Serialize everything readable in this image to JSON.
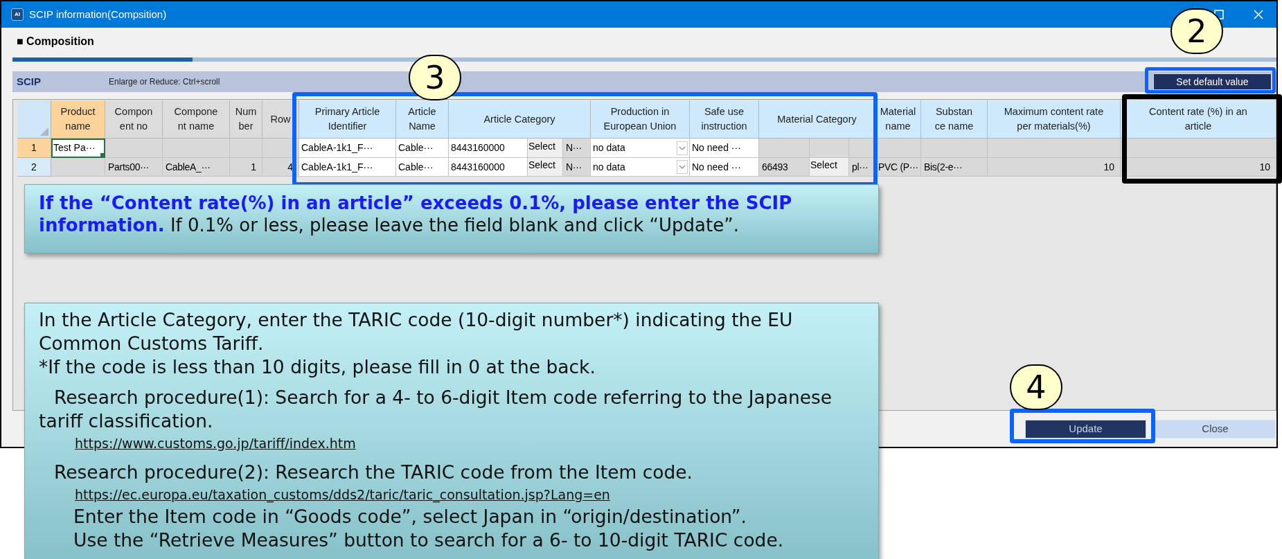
{
  "window": {
    "icon_label": "AI",
    "title": "SCIP information(Compsition)",
    "controls": [
      {
        "kind": "maximize"
      },
      {
        "kind": "close"
      }
    ]
  },
  "section": {
    "title": "■ Composition"
  },
  "toolbar": {
    "label": "SCIP",
    "hint": "Enlarge or Reduce: Ctrl+scroll",
    "button": "Set default value"
  },
  "table": {
    "columns": [
      {
        "lines": [
          "Product",
          "name"
        ],
        "selected": true,
        "editable": false
      },
      {
        "lines": [
          "Compon",
          "ent no"
        ],
        "selected": false,
        "editable": false
      },
      {
        "lines": [
          "Compone",
          "nt name"
        ],
        "selected": false,
        "editable": false
      },
      {
        "lines": [
          "Num",
          "ber"
        ],
        "selected": false,
        "editable": false
      },
      {
        "lines": [
          "Row"
        ],
        "selected": false,
        "editable": false
      },
      {
        "lines": [
          "Primary Article",
          "Identifier"
        ],
        "selected": false,
        "editable": true
      },
      {
        "lines": [
          "Article",
          "Name"
        ],
        "selected": false,
        "editable": true
      },
      {
        "lines": [
          "Article Category"
        ],
        "selected": false,
        "editable": true
      },
      {
        "lines": [
          "Production in",
          "European Union"
        ],
        "selected": false,
        "editable": true
      },
      {
        "lines": [
          "Safe use",
          "instruction"
        ],
        "selected": false,
        "editable": true
      },
      {
        "lines": [
          "Material Category"
        ],
        "selected": false,
        "editable": true
      },
      {
        "lines": [
          "Material",
          "name"
        ],
        "selected": false,
        "editable": true
      },
      {
        "lines": [
          "Substan",
          "ce name"
        ],
        "selected": false,
        "editable": true
      },
      {
        "lines": [
          "Maximum content rate",
          "per materials(%)"
        ],
        "selected": false,
        "editable": true
      },
      {
        "lines": [
          "Content rate (%) in an",
          "article"
        ],
        "selected": false,
        "editable": true
      }
    ],
    "rows": [
      {
        "number": "1",
        "selected": true,
        "cells": [
          {
            "kind": "field",
            "text": "Test Pa···",
            "selected": true
          },
          {
            "kind": "readonly"
          },
          {
            "kind": "readonly"
          },
          {
            "kind": "readonly"
          },
          {
            "kind": "readonly"
          },
          {
            "kind": "field",
            "text": "CableA-1k1_F···"
          },
          {
            "kind": "field",
            "text": "Cable···"
          },
          {
            "parts": [
              {
                "kind": "field",
                "text": "8443160000"
              },
              {
                "kind": "button",
                "text": "Select"
              },
              {
                "kind": "readonly",
                "text": "N···"
              }
            ]
          },
          {
            "kind": "dropdown",
            "text": "no data"
          },
          {
            "kind": "field",
            "text": "No need ···"
          },
          {
            "parts": [
              {
                "kind": "readonly"
              },
              {
                "kind": "readonly"
              },
              {
                "kind": "readonly"
              }
            ]
          },
          {
            "kind": "readonly"
          },
          {
            "kind": "readonly"
          },
          {
            "kind": "readonly"
          },
          {
            "kind": "readonly"
          }
        ]
      },
      {
        "number": "2",
        "selected": false,
        "cells": [
          {
            "kind": "readonly"
          },
          {
            "kind": "readonly",
            "text": "Parts00···"
          },
          {
            "kind": "readonly",
            "text": "CableA_···"
          },
          {
            "kind": "number",
            "text": "1"
          },
          {
            "kind": "number",
            "text": "4"
          },
          {
            "kind": "field",
            "text": "CableA-1k1_F···"
          },
          {
            "kind": "field",
            "text": "Cable···"
          },
          {
            "parts": [
              {
                "kind": "field",
                "text": "8443160000"
              },
              {
                "kind": "button",
                "text": "Select"
              },
              {
                "kind": "readonly",
                "text": "N···"
              }
            ]
          },
          {
            "kind": "dropdown",
            "text": "no data"
          },
          {
            "kind": "field",
            "text": "No need ···"
          },
          {
            "parts": [
              {
                "kind": "readonly",
                "text": "66493"
              },
              {
                "kind": "button",
                "text": "Select"
              },
              {
                "kind": "readonly",
                "text": "pl···"
              }
            ]
          },
          {
            "kind": "readonly",
            "text": "PVC (P···"
          },
          {
            "kind": "readonly",
            "text": "Bis(2-e···"
          },
          {
            "kind": "number",
            "text": "10"
          },
          {
            "kind": "number",
            "text": "10"
          }
        ]
      }
    ]
  },
  "buttons": [
    {
      "label": "Update",
      "kind": "primary"
    },
    {
      "label": "Close",
      "kind": "secondary"
    }
  ],
  "annotations": {
    "highlights": [
      {
        "color": "#0a64ff"
      },
      {
        "color": "#0a64ff"
      },
      {
        "color": "#000000"
      },
      {
        "color": "#0a64ff"
      }
    ],
    "markers": [
      {
        "number": "3"
      },
      {
        "number": "2"
      },
      {
        "number": "4"
      }
    ],
    "callouts": [
      {
        "kind": "notice",
        "text": "**If the “Content rate(%) in an article” exceeds 0.1%, please enter the SCIP information.** If 0.1% or less, please leave the field blank and click “Update”."
      },
      {
        "kind": "guide",
        "lines": [
          {
            "kind": "text",
            "text": "In the Article Category, enter the TARIC code (10-digit number*) indicating the EU Common Customs Tariff."
          },
          {
            "kind": "text",
            "text": "*If the code is less than 10 digits, please fill in 0 at the back."
          },
          {
            "kind": "step",
            "text": "Research procedure(1): Search for a 4- to 6-digit Item code referring to the Japanese tariff classification."
          },
          {
            "kind": "link",
            "text": "https://www.customs.go.jp/tariff/index.htm"
          },
          {
            "kind": "step",
            "text": "Research procedure(2): Research the TARIC code from the Item code."
          },
          {
            "kind": "link",
            "text": "https://ec.europa.eu/taxation_customs/dds2/taric/taric_consultation.jsp?Lang=en"
          },
          {
            "kind": "instruction",
            "text": "Enter the Item code in “Goods code”, select Japan in “origin/destination”."
          },
          {
            "kind": "instruction",
            "text": "Use the “Retrieve Measures” button to search for a 6- to 10-digit TARIC code."
          }
        ]
      }
    ]
  }
}
